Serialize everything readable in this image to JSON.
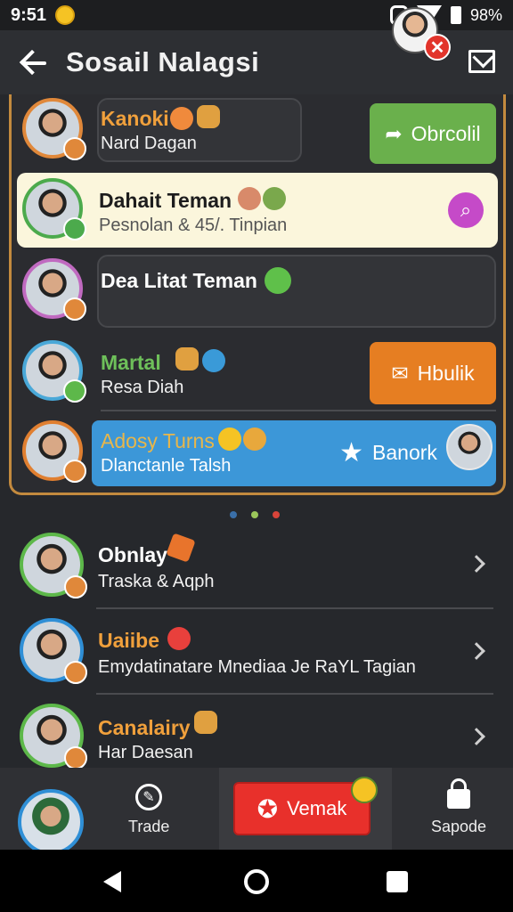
{
  "status": {
    "time": "9:51",
    "battery": "98%"
  },
  "appbar": {
    "title": "Sosail Nalagsi",
    "badge": "✕"
  },
  "friends": [
    {
      "name": "Kanoki",
      "sub": "Nard Dagan",
      "name_color": "#f0a03c",
      "ring": "#e0883a",
      "action": "Obrcolil",
      "action_color": "#6ab04c"
    },
    {
      "name": "Dahait Teman",
      "sub": "Pesnolan & 45/. Tinpian",
      "name_color": "#1d1d1d",
      "ring": "#4caa4c"
    },
    {
      "name": "Dea Litat Teman",
      "sub": "",
      "name_color": "#ffffff",
      "ring": "#c06ac0"
    },
    {
      "name": "Martal",
      "sub": "Resa Diah",
      "name_color": "#6ec05a",
      "ring": "#49a8d8",
      "action": "Hbulik",
      "action_color": "#e67e22"
    },
    {
      "name": "Adosy Turns",
      "sub": "Dlanctanle Talsh",
      "name_color": "#e8b64a",
      "ring": "#e07f30",
      "action": "Banork"
    }
  ],
  "contacts": [
    {
      "name": "Obnlay",
      "sub": "Traska & Aqph",
      "name_color": "#ffffff",
      "ring": "#5db84a"
    },
    {
      "name": "Uaiibe",
      "sub": "Emydatinatare Mnediaa Je RaYL Tagian",
      "name_color": "#f0a03c",
      "ring": "#2f8fd6"
    },
    {
      "name": "Canalairy",
      "sub": "Har Daesan",
      "name_color": "#f0a03c",
      "ring": "#5db84a"
    }
  ],
  "bottomnav": {
    "trade": "Trade",
    "vemak": "Vemak",
    "sapode": "Sapode"
  },
  "icons": [
    "back-arrow-icon",
    "mail-icon",
    "share-arrow-icon",
    "search-icon",
    "envelope-icon",
    "star-icon",
    "chevron-right-icon",
    "wrench-icon",
    "lock-icon",
    "star-burst-icon"
  ]
}
